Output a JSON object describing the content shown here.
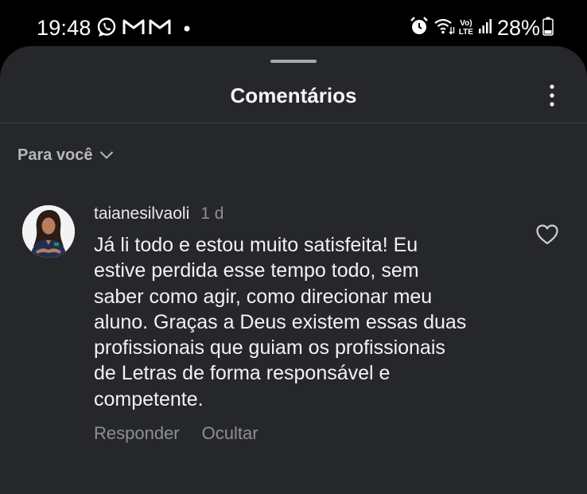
{
  "status_bar": {
    "time": "19:48",
    "notification_icons": [
      "whatsapp-icon",
      "gmail-icon",
      "gmail-icon",
      "more-notifications-dot"
    ],
    "system_icons": [
      "alarm-icon",
      "wifi-icon",
      "volte-icon",
      "signal-icon",
      "battery-icon"
    ],
    "volte_label_top": "Vo)",
    "volte_label_bottom": "LTE",
    "battery_percent": "28%"
  },
  "sheet": {
    "title": "Comentários",
    "menu_icon": "more-vertical-icon",
    "filter_label": "Para você",
    "filter_icon": "chevron-down-icon"
  },
  "comments": [
    {
      "username": "taianesilvaoli",
      "time": "1 d",
      "text": "Já li todo e estou muito satisfeita! Eu\nestive perdida esse tempo todo, sem\nsaber como agir, como direcionar meu\naluno. Graças a Deus existem essas duas\nprofissionais que guiam os profissionais\nde Letras de forma responsável e\ncompetente.",
      "reply_label": "Responder",
      "hide_label": "Ocultar",
      "like_icon": "heart-outline-icon"
    }
  ],
  "colors": {
    "sheet_background": "#26272b",
    "status_bar_background": "#000000",
    "primary_text": "#f5f5f5",
    "secondary_text": "#8e8f93"
  }
}
